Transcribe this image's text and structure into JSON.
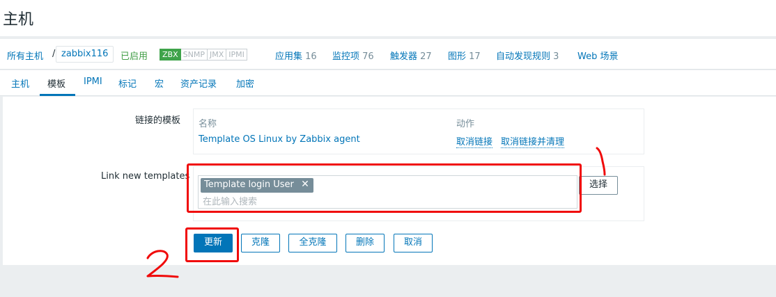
{
  "page_title": "主机",
  "breadcrumb": {
    "all_hosts": "所有主机",
    "separator": "/",
    "host": "zabbix116",
    "status": "已启用",
    "availability": [
      "ZBX",
      "SNMP",
      "JMX",
      "IPMI"
    ],
    "items": [
      {
        "label": "应用集",
        "count": "16"
      },
      {
        "label": "监控项",
        "count": "76"
      },
      {
        "label": "触发器",
        "count": "27"
      },
      {
        "label": "图形",
        "count": "17"
      },
      {
        "label": "自动发现规则",
        "count": "3"
      },
      {
        "label": "Web 场景",
        "count": ""
      }
    ]
  },
  "tabs": [
    "主机",
    "模板",
    "IPMI",
    "标记",
    "宏",
    "资产记录",
    "加密"
  ],
  "active_tab": "模板",
  "linked_templates": {
    "label": "链接的模板",
    "col_name": "名称",
    "col_action": "动作",
    "rows": [
      {
        "name": "Template OS Linux by Zabbix agent",
        "unlink": "取消链接",
        "unlink_clear": "取消链接并清理"
      }
    ]
  },
  "link_new": {
    "label": "Link new templates",
    "selected": "Template login User",
    "placeholder": "在此输入搜索",
    "select_button": "选择"
  },
  "buttons": {
    "update": "更新",
    "clone": "克隆",
    "full_clone": "全克隆",
    "delete": "删除",
    "cancel": "取消"
  },
  "annotations": [
    "1",
    "2"
  ],
  "colors": {
    "accent": "#0275b8",
    "enabled": "#429e47",
    "annotation": "#f00a0a",
    "chip": "#768d99"
  }
}
